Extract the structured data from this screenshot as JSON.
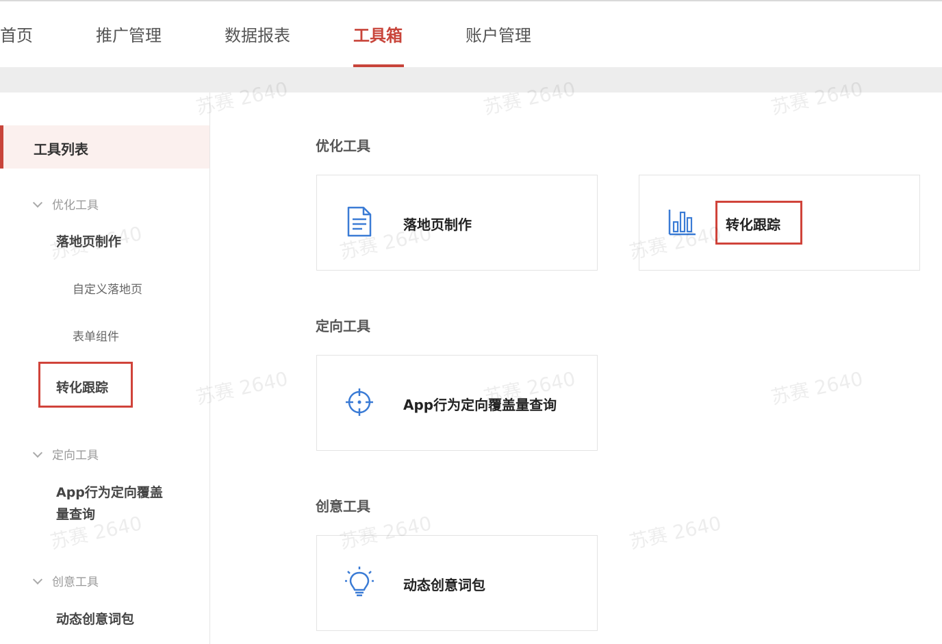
{
  "nav": {
    "tabs": [
      {
        "label": "首页"
      },
      {
        "label": "推广管理"
      },
      {
        "label": "数据报表"
      },
      {
        "label": "工具箱"
      },
      {
        "label": "账户管理"
      }
    ],
    "active_tab": "工具箱"
  },
  "sidebar": {
    "list_title": "工具列表",
    "groups": [
      {
        "label": "优化工具"
      },
      {
        "label": "定向工具"
      },
      {
        "label": "创意工具"
      }
    ],
    "items": {
      "landing_page": "落地页制作",
      "custom_landing": "自定义落地页",
      "form_component": "表单组件",
      "conversion_tracking": "转化跟踪",
      "app_targeting_line1": "App行为定向覆盖",
      "app_targeting_line2": "量查询",
      "dynamic_words": "动态创意词包"
    }
  },
  "main": {
    "sections": [
      {
        "title": "优化工具"
      },
      {
        "title": "定向工具"
      },
      {
        "title": "创意工具"
      }
    ],
    "cards": {
      "landing_page": {
        "label": "落地页制作",
        "icon": "document-icon"
      },
      "conversion_tracking": {
        "label": "转化跟踪",
        "icon": "bar-chart-icon"
      },
      "app_targeting": {
        "label": "App行为定向覆盖量查询",
        "icon": "crosshair-icon"
      },
      "dynamic_words": {
        "label": "动态创意词包",
        "icon": "lightbulb-icon"
      }
    }
  },
  "watermark": "苏赛 2640",
  "colors": {
    "accent": "#c8443a",
    "icon_blue": "#3a7bd5",
    "highlight_box": "#d0433a"
  }
}
